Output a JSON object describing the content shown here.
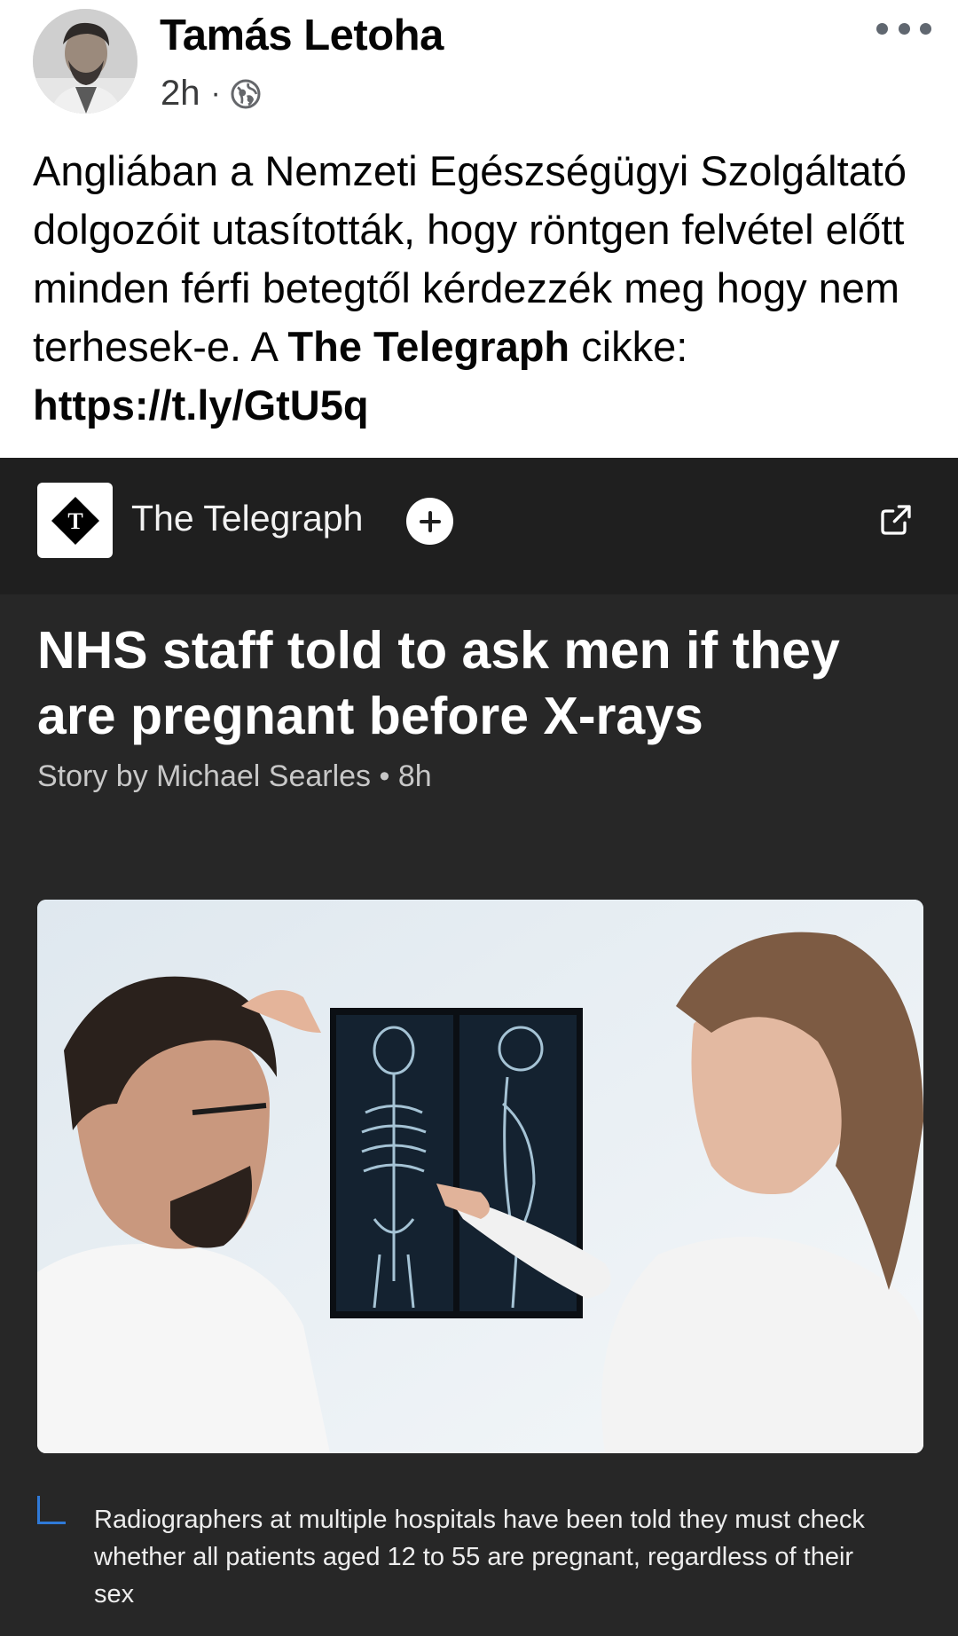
{
  "post": {
    "author": "Tamás Letoha",
    "time": "2h",
    "separator": "·",
    "text_parts": {
      "t1": "Angliában a Nemzeti Egészségügyi Szolgáltató dolgozóit utasították, hogy röntgen felvétel előtt minden férfi betegtől kérdezzék meg hogy nem terhesek-e. A ",
      "bold_source": "The Telegraph",
      "t2": " cikke: ",
      "link": "https://t.ly/GtU5q"
    }
  },
  "card": {
    "publisher": "The Telegraph",
    "headline": "NHS staff told to ask men if they are pregnant before X-rays",
    "byline": "Story by Michael Searles • 8h",
    "caption": "Radiographers at multiple hospitals have been told they must check whether all patients aged 12 to 55 are pregnant, regardless of their sex"
  },
  "icons": {
    "more": "more-horizontal-icon",
    "globe": "globe-icon",
    "follow": "plus-icon",
    "external": "external-link-icon"
  },
  "colors": {
    "card_bg": "#272727",
    "card_top_bg": "#1f1f1f",
    "caption_accent": "#2f7ad8"
  }
}
